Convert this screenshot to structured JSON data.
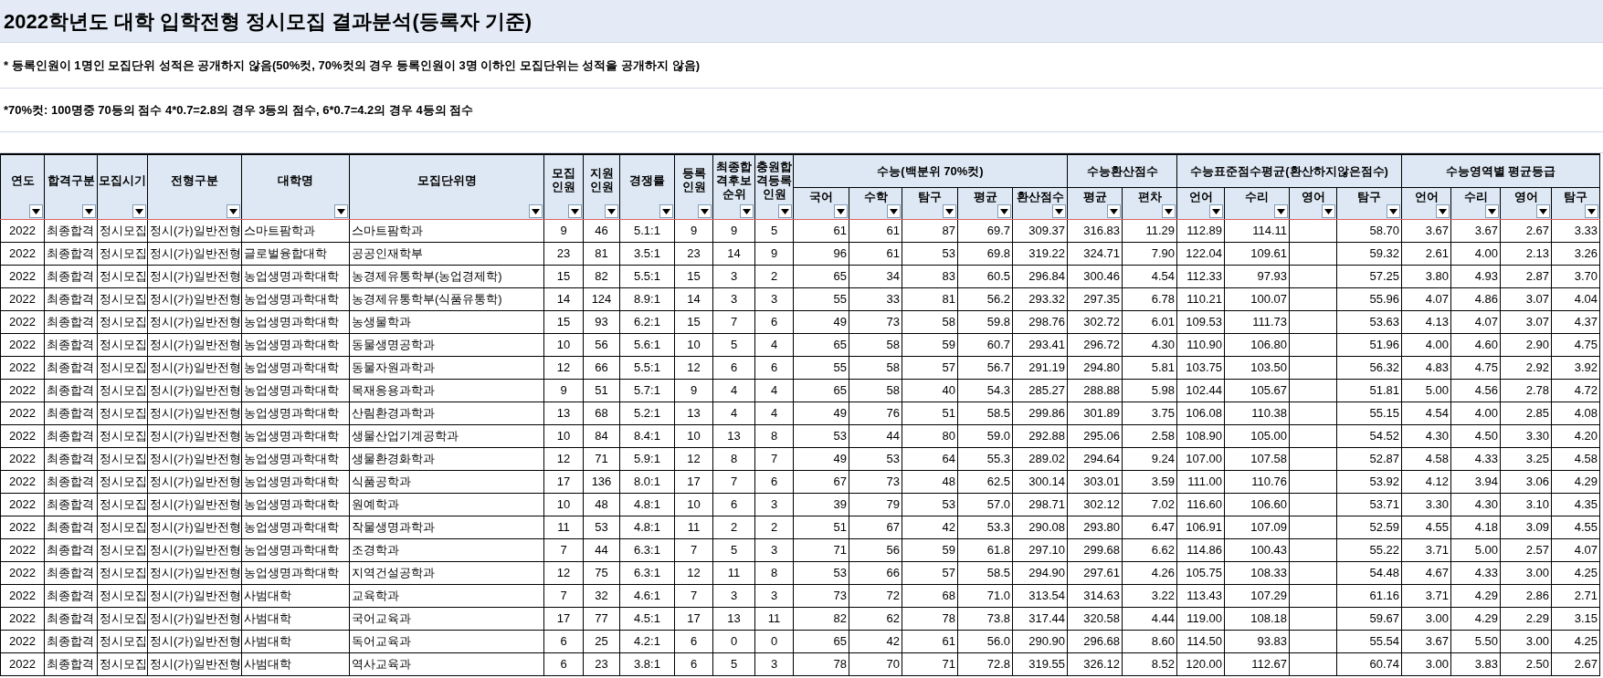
{
  "title": "2022학년도 대학 입학전형 정시모집 결과분석(등록자 기준)",
  "notes": [
    "* 등록인원이 1명인 모집단위 성적은 공개하지 않음(50%컷, 70%컷의 경우 등록인원이 3명 이하인 모집단위는 성적을 공개하지 않음)",
    "*70%컷: 100명중 70등의 점수 4*0.7=2.8의 경우 3등의 점수, 6*0.7=4.2의 경우 4등의 점수"
  ],
  "table": {
    "header": [
      {
        "label": "연도"
      },
      {
        "label": "합격구분"
      },
      {
        "label": "모집시기"
      },
      {
        "label": "전형구분"
      },
      {
        "label": "대학명"
      },
      {
        "label": "모집단위명"
      },
      {
        "label": "모집 인원"
      },
      {
        "label": "지원 인원"
      },
      {
        "label": "경쟁률"
      },
      {
        "label": "등록 인원"
      },
      {
        "label": "최종합격후보순위"
      },
      {
        "label": "충원합격등록인원"
      },
      {
        "label": "수능(백분위 70%컷)",
        "columns": [
          "국어",
          "수학",
          "탐구",
          "평균",
          "환산점수"
        ]
      },
      {
        "label": "수능환산점수",
        "columns": [
          "평균",
          "편차"
        ]
      },
      {
        "label": "수능표준점수평균(환산하지않은점수)",
        "columns": [
          "언어",
          "수리",
          "영어",
          "탐구"
        ]
      },
      {
        "label": "수능영역별 평균등급",
        "columns": [
          "언어",
          "수리",
          "영어",
          "탐구"
        ]
      }
    ],
    "rows": [
      [
        "2022",
        "최종합격",
        "정시모집",
        "정시(가)일반전형",
        "스마트팜학과",
        "스마트팜학과",
        "9",
        "46",
        "5.1:1",
        "9",
        "9",
        "5",
        "61",
        "61",
        "87",
        "69.7",
        "309.37",
        "316.83",
        "11.29",
        "112.89",
        "114.11",
        null,
        "58.70",
        "3.67",
        "3.67",
        "2.67",
        "3.33"
      ],
      [
        "2022",
        "최종합격",
        "정시모집",
        "정시(가)일반전형",
        "글로벌융합대학",
        "공공인재학부",
        "23",
        "81",
        "3.5:1",
        "23",
        "14",
        "9",
        "96",
        "61",
        "53",
        "69.8",
        "319.22",
        "324.71",
        "7.90",
        "122.04",
        "109.61",
        null,
        "59.32",
        "2.61",
        "4.00",
        "2.13",
        "3.26"
      ],
      [
        "2022",
        "최종합격",
        "정시모집",
        "정시(가)일반전형",
        "농업생명과학대학",
        "농경제유통학부(농업경제학)",
        "15",
        "82",
        "5.5:1",
        "15",
        "3",
        "2",
        "65",
        "34",
        "83",
        "60.5",
        "296.84",
        "300.46",
        "4.54",
        "112.33",
        "97.93",
        null,
        "57.25",
        "3.80",
        "4.93",
        "2.87",
        "3.70"
      ],
      [
        "2022",
        "최종합격",
        "정시모집",
        "정시(가)일반전형",
        "농업생명과학대학",
        "농경제유통학부(식품유통학)",
        "14",
        "124",
        "8.9:1",
        "14",
        "3",
        "3",
        "55",
        "33",
        "81",
        "56.2",
        "293.32",
        "297.35",
        "6.78",
        "110.21",
        "100.07",
        null,
        "55.96",
        "4.07",
        "4.86",
        "3.07",
        "4.04"
      ],
      [
        "2022",
        "최종합격",
        "정시모집",
        "정시(가)일반전형",
        "농업생명과학대학",
        "농생물학과",
        "15",
        "93",
        "6.2:1",
        "15",
        "7",
        "6",
        "49",
        "73",
        "58",
        "59.8",
        "298.76",
        "302.72",
        "6.01",
        "109.53",
        "111.73",
        null,
        "53.63",
        "4.13",
        "4.07",
        "3.07",
        "4.37"
      ],
      [
        "2022",
        "최종합격",
        "정시모집",
        "정시(가)일반전형",
        "농업생명과학대학",
        "동물생명공학과",
        "10",
        "56",
        "5.6:1",
        "10",
        "5",
        "4",
        "65",
        "58",
        "59",
        "60.7",
        "293.41",
        "296.72",
        "4.30",
        "110.90",
        "106.80",
        null,
        "51.96",
        "4.00",
        "4.60",
        "2.90",
        "4.75"
      ],
      [
        "2022",
        "최종합격",
        "정시모집",
        "정시(가)일반전형",
        "농업생명과학대학",
        "동물자원과학과",
        "12",
        "66",
        "5.5:1",
        "12",
        "6",
        "6",
        "55",
        "58",
        "57",
        "56.7",
        "291.19",
        "294.80",
        "5.81",
        "103.75",
        "103.50",
        null,
        "56.32",
        "4.83",
        "4.75",
        "2.92",
        "3.92"
      ],
      [
        "2022",
        "최종합격",
        "정시모집",
        "정시(가)일반전형",
        "농업생명과학대학",
        "목재응용과학과",
        "9",
        "51",
        "5.7:1",
        "9",
        "4",
        "4",
        "65",
        "58",
        "40",
        "54.3",
        "285.27",
        "288.88",
        "5.98",
        "102.44",
        "105.67",
        null,
        "51.81",
        "5.00",
        "4.56",
        "2.78",
        "4.72"
      ],
      [
        "2022",
        "최종합격",
        "정시모집",
        "정시(가)일반전형",
        "농업생명과학대학",
        "산림환경과학과",
        "13",
        "68",
        "5.2:1",
        "13",
        "4",
        "4",
        "49",
        "76",
        "51",
        "58.5",
        "299.86",
        "301.89",
        "3.75",
        "106.08",
        "110.38",
        null,
        "55.15",
        "4.54",
        "4.00",
        "2.85",
        "4.08"
      ],
      [
        "2022",
        "최종합격",
        "정시모집",
        "정시(가)일반전형",
        "농업생명과학대학",
        "생물산업기계공학과",
        "10",
        "84",
        "8.4:1",
        "10",
        "13",
        "8",
        "53",
        "44",
        "80",
        "59.0",
        "292.88",
        "295.06",
        "2.58",
        "108.90",
        "105.00",
        null,
        "54.52",
        "4.30",
        "4.50",
        "3.30",
        "4.20"
      ],
      [
        "2022",
        "최종합격",
        "정시모집",
        "정시(가)일반전형",
        "농업생명과학대학",
        "생물환경화학과",
        "12",
        "71",
        "5.9:1",
        "12",
        "8",
        "7",
        "49",
        "53",
        "64",
        "55.3",
        "289.02",
        "294.64",
        "9.24",
        "107.00",
        "107.58",
        null,
        "52.87",
        "4.58",
        "4.33",
        "3.25",
        "4.58"
      ],
      [
        "2022",
        "최종합격",
        "정시모집",
        "정시(가)일반전형",
        "농업생명과학대학",
        "식품공학과",
        "17",
        "136",
        "8.0:1",
        "17",
        "7",
        "6",
        "67",
        "73",
        "48",
        "62.5",
        "300.14",
        "303.01",
        "3.59",
        "111.00",
        "110.76",
        null,
        "53.92",
        "4.12",
        "3.94",
        "3.06",
        "4.29"
      ],
      [
        "2022",
        "최종합격",
        "정시모집",
        "정시(가)일반전형",
        "농업생명과학대학",
        "원예학과",
        "10",
        "48",
        "4.8:1",
        "10",
        "6",
        "3",
        "39",
        "79",
        "53",
        "57.0",
        "298.71",
        "302.12",
        "7.02",
        "116.60",
        "106.60",
        null,
        "53.71",
        "3.30",
        "4.30",
        "3.10",
        "4.35"
      ],
      [
        "2022",
        "최종합격",
        "정시모집",
        "정시(가)일반전형",
        "농업생명과학대학",
        "작물생명과학과",
        "11",
        "53",
        "4.8:1",
        "11",
        "2",
        "2",
        "51",
        "67",
        "42",
        "53.3",
        "290.08",
        "293.80",
        "6.47",
        "106.91",
        "107.09",
        null,
        "52.59",
        "4.55",
        "4.18",
        "3.09",
        "4.55"
      ],
      [
        "2022",
        "최종합격",
        "정시모집",
        "정시(가)일반전형",
        "농업생명과학대학",
        "조경학과",
        "7",
        "44",
        "6.3:1",
        "7",
        "5",
        "3",
        "71",
        "56",
        "59",
        "61.8",
        "297.10",
        "299.68",
        "6.62",
        "114.86",
        "100.43",
        null,
        "55.22",
        "3.71",
        "5.00",
        "2.57",
        "4.07"
      ],
      [
        "2022",
        "최종합격",
        "정시모집",
        "정시(가)일반전형",
        "농업생명과학대학",
        "지역건설공학과",
        "12",
        "75",
        "6.3:1",
        "12",
        "11",
        "8",
        "53",
        "66",
        "57",
        "58.5",
        "294.90",
        "297.61",
        "4.26",
        "105.75",
        "108.33",
        null,
        "54.48",
        "4.67",
        "4.33",
        "3.00",
        "4.25"
      ],
      [
        "2022",
        "최종합격",
        "정시모집",
        "정시(가)일반전형",
        "사범대학",
        "교육학과",
        "7",
        "32",
        "4.6:1",
        "7",
        "3",
        "3",
        "73",
        "72",
        "68",
        "71.0",
        "313.54",
        "314.63",
        "3.22",
        "113.43",
        "107.29",
        null,
        "61.16",
        "3.71",
        "4.29",
        "2.86",
        "2.71"
      ],
      [
        "2022",
        "최종합격",
        "정시모집",
        "정시(가)일반전형",
        "사범대학",
        "국어교육과",
        "17",
        "77",
        "4.5:1",
        "17",
        "13",
        "11",
        "82",
        "62",
        "78",
        "73.8",
        "317.44",
        "320.58",
        "4.44",
        "119.00",
        "108.18",
        null,
        "59.67",
        "3.00",
        "4.29",
        "2.29",
        "3.15"
      ],
      [
        "2022",
        "최종합격",
        "정시모집",
        "정시(가)일반전형",
        "사범대학",
        "독어교육과",
        "6",
        "25",
        "4.2:1",
        "6",
        "0",
        "0",
        "65",
        "42",
        "61",
        "56.0",
        "290.90",
        "296.68",
        "8.60",
        "114.50",
        "93.83",
        null,
        "55.54",
        "3.67",
        "5.50",
        "3.00",
        "4.25"
      ],
      [
        "2022",
        "최종합격",
        "정시모집",
        "정시(가)일반전형",
        "사범대학",
        "역사교육과",
        "6",
        "23",
        "3.8:1",
        "6",
        "5",
        "3",
        "78",
        "70",
        "71",
        "72.8",
        "319.55",
        "326.12",
        "8.52",
        "120.00",
        "112.67",
        null,
        "60.74",
        "3.00",
        "3.83",
        "2.50",
        "2.67"
      ]
    ]
  }
}
